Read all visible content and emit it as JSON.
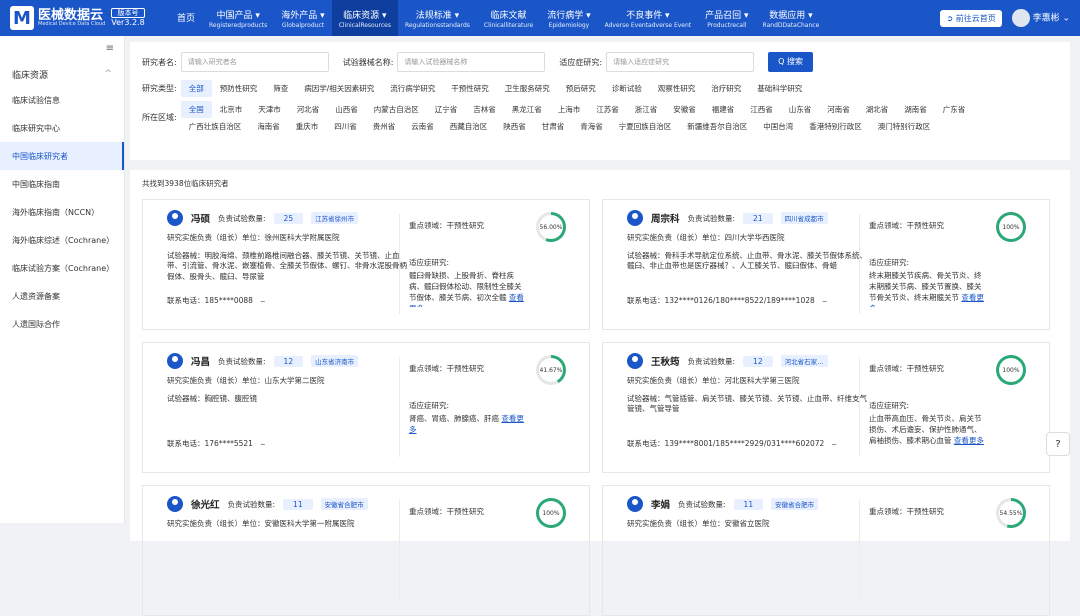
{
  "brand": {
    "title": "医械数据云",
    "subtitle": "Medical Device Data Cloud",
    "version_badge": "版本号",
    "version": "Ver3.2.8"
  },
  "nav": [
    {
      "zh": "首页",
      "en": ""
    },
    {
      "zh": "中国产品 ▾",
      "en": "Registeredproducts"
    },
    {
      "zh": "海外产品 ▾",
      "en": "Globalproduct"
    },
    {
      "zh": "临床资源 ▾",
      "en": "ClinicalResources"
    },
    {
      "zh": "法规标准 ▾",
      "en": "Regulationsstandards"
    },
    {
      "zh": "临床文献",
      "en": "Clinicalliterature"
    },
    {
      "zh": "流行病学 ▾",
      "en": "Epidemiology"
    },
    {
      "zh": "不良事件 ▾",
      "en": "Adverse Eventadverse Event"
    },
    {
      "zh": "产品召回 ▾",
      "en": "Productrecall"
    },
    {
      "zh": "数据应用 ▾",
      "en": "RandDDataChance"
    }
  ],
  "topright": {
    "cloud_btn": "➲ 前往云首页",
    "user": "李惠彬 ⌄"
  },
  "sidebar": {
    "toggle": "≡",
    "group": "临床资源",
    "group_arrow": "^",
    "items": [
      "临床试验信息",
      "临床研究中心",
      "中国临床研究者",
      "中国临床指南",
      "海外临床指南（NCCN）",
      "海外临床综述（Cochrane）",
      "临床试验方案（Cochrane）",
      "人遗资源备案",
      "人遗国际合作"
    ]
  },
  "filter": {
    "researcher_label": "研究者名:",
    "researcher_ph": "请输入研究者名",
    "device_label": "试验器械名称:",
    "device_ph": "请输入试验器械名称",
    "indication_label": "适应症研究:",
    "indication_ph": "请输入适应症研究",
    "search_btn": "Q 搜索",
    "type_label": "研究类型:",
    "types": [
      "全部",
      "预防性研究",
      "筛查",
      "病因学/相关因素研究",
      "流行病学研究",
      "干预性研究",
      "卫生服务研究",
      "预后研究",
      "诊断试验",
      "观察性研究",
      "治疗研究",
      "基础科学研究"
    ],
    "region_label": "所在区域:",
    "regions": [
      "全国",
      "北京市",
      "天津市",
      "河北省",
      "山西省",
      "内蒙古自治区",
      "辽宁省",
      "吉林省",
      "黑龙江省",
      "上海市",
      "江苏省",
      "浙江省",
      "安徽省",
      "福建省",
      "江西省",
      "山东省",
      "河南省",
      "湖北省",
      "湖南省",
      "广东省",
      "广西壮族自治区",
      "海南省",
      "重庆市",
      "四川省",
      "贵州省",
      "云南省",
      "西藏自治区",
      "陕西省",
      "甘肃省",
      "青海省",
      "宁夏回族自治区",
      "新疆维吾尔自治区",
      "中国台湾",
      "香港特别行政区",
      "澳门特别行政区"
    ]
  },
  "results": {
    "count_text": "共找到3938位临床研究者",
    "count_label": "负责试验数量:",
    "focus_label": "重点领域:",
    "indication_label": "适应症研究:",
    "more": "查看更多",
    "cards": [
      {
        "name": "冯硕",
        "count": "25",
        "city": "江苏省徐州市",
        "unit": "研究实施负责（组长）单位：徐州医科大学附属医院",
        "device": "试验器械：明胶海绵、颈椎前路椎间融合器、膝关节镜、关节镜、止血带、引流管、骨水泥、嵌塞植骨、全膝关节假体、螺钉、非骨水泥股骨柄假体、股骨头、髋臼、导尿管",
        "phone": "联系电话：185****0088　⌣",
        "focus": "重点领域：干预性研究",
        "ind": "髋臼骨缺损、上股骨折、脊柱疾病、髋臼假体松动、限制性全膝关节假体、膝关节病、初次全髋",
        "pct": "56.00%",
        "val": 56,
        "color": "#2aa876"
      },
      {
        "name": "周宗科",
        "count": "21",
        "city": "四川省成都市",
        "unit": "研究实施负责（组长）单位：四川大学华西医院",
        "device": "试验器械：骨科手术导航定位系统、止血带、骨水泥、膝关节假体系统、髋臼、非止血带也是医疗器械？、人工膝关节、髋臼假体、骨蜡",
        "phone": "联系电话：132****0126/180****8522/189****1028　⌣",
        "focus": "重点领域：干预性研究",
        "ind": "终末期膝关节疾病、骨关节炎、终末期膝关节病、膝关节置换、膝关节骨关节炎、终末期髋关节",
        "pct": "100%",
        "val": 100,
        "color": "#2aa876"
      },
      {
        "name": "冯昌",
        "count": "12",
        "city": "山东省济南市",
        "unit": "研究实施负责（组长）单位：山东大学第二医院",
        "device": "试验器械：胸腔镜、腹腔镜",
        "phone": "联系电话：176****5521　⌣",
        "focus": "重点领域：干预性研究",
        "ind": "肾癌、胃癌、肺腺癌、肝癌",
        "pct": "41.67%",
        "val": 41.67,
        "color": "#2aa876"
      },
      {
        "name": "王秋筠",
        "count": "12",
        "city": "河北省石家…",
        "unit": "研究实施负责（组长）单位：河北医科大学第三医院",
        "device": "试验器械：气管插管、肩关节镜、膝关节镜、关节镜、止血带、纤维支气管镜、气管导管",
        "phone": "联系电话：139****8001/185****2929/031****602072　⌣",
        "focus": "重点领域：干预性研究",
        "ind": "止血带高血压、骨关节炎、肩关节损伤、术后谵妄、保护性肺通气、肩袖损伤、膝术期心血管",
        "pct": "100%",
        "val": 100,
        "color": "#2aa876"
      },
      {
        "name": "徐光红",
        "count": "11",
        "city": "安徽省合肥市",
        "unit": "研究实施负责（组长）单位：安徽医科大学第一附属医院",
        "device": "",
        "phone": "",
        "focus": "重点领域：干预性研究",
        "ind": "",
        "pct": "100%",
        "val": 100,
        "color": "#2aa876"
      },
      {
        "name": "李娟",
        "count": "11",
        "city": "安徽省合肥市",
        "unit": "研究实施负责（组长）单位：安徽省立医院",
        "device": "",
        "phone": "",
        "focus": "重点领域：干预性研究",
        "ind": "",
        "pct": "54.55%",
        "val": 54.55,
        "color": "#2aa876"
      }
    ]
  },
  "float_icon": "?"
}
